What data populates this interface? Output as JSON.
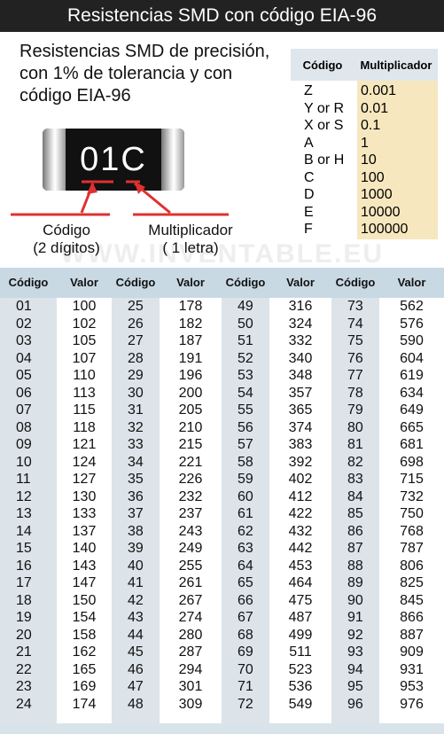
{
  "title": "Resistencias SMD con código EIA-96",
  "heading": [
    "Resistencias SMD de precisión,",
    "con 1% de tolerancia y con",
    "código EIA-96"
  ],
  "resistor": {
    "code": "01C"
  },
  "labels": {
    "codigo": "Código",
    "codigo_sub": "(2 dígitos)",
    "multiplicador": "Multiplicador",
    "multiplicador_sub": "( 1 letra)"
  },
  "watermark": "WWW.INVENTABLE.EU",
  "multiplier_table": {
    "headers": [
      "Código",
      "Multiplicador"
    ],
    "codes": [
      "Z",
      "Y or R",
      "X or S",
      "A",
      "B or H",
      "C",
      "D",
      "E",
      "F"
    ],
    "values": [
      "0.001",
      "0.01",
      "0.1",
      "1",
      "10",
      "100",
      "1000",
      "10000",
      "100000"
    ]
  },
  "value_table": {
    "headers": [
      "Código",
      "Valor",
      "Código",
      "Valor",
      "Código",
      "Valor",
      "Código",
      "Valor"
    ],
    "groups": [
      {
        "codes": [
          "01",
          "02",
          "03",
          "04",
          "05",
          "06",
          "07",
          "08",
          "09",
          "10",
          "11",
          "12",
          "13",
          "14",
          "15",
          "16",
          "17",
          "18",
          "19",
          "20",
          "21",
          "22",
          "23",
          "24"
        ],
        "values": [
          "100",
          "102",
          "105",
          "107",
          "110",
          "113",
          "115",
          "118",
          "121",
          "124",
          "127",
          "130",
          "133",
          "137",
          "140",
          "143",
          "147",
          "150",
          "154",
          "158",
          "162",
          "165",
          "169",
          "174"
        ]
      },
      {
        "codes": [
          "25",
          "26",
          "27",
          "28",
          "29",
          "30",
          "31",
          "32",
          "33",
          "34",
          "35",
          "36",
          "37",
          "38",
          "39",
          "40",
          "41",
          "42",
          "43",
          "44",
          "45",
          "46",
          "47",
          "48"
        ],
        "values": [
          "178",
          "182",
          "187",
          "191",
          "196",
          "200",
          "205",
          "210",
          "215",
          "221",
          "226",
          "232",
          "237",
          "243",
          "249",
          "255",
          "261",
          "267",
          "274",
          "280",
          "287",
          "294",
          "301",
          "309"
        ]
      },
      {
        "codes": [
          "49",
          "50",
          "51",
          "52",
          "53",
          "54",
          "55",
          "56",
          "57",
          "58",
          "59",
          "60",
          "61",
          "62",
          "63",
          "64",
          "65",
          "66",
          "67",
          "68",
          "69",
          "70",
          "71",
          "72"
        ],
        "values": [
          "316",
          "324",
          "332",
          "340",
          "348",
          "357",
          "365",
          "374",
          "383",
          "392",
          "402",
          "412",
          "422",
          "432",
          "442",
          "453",
          "464",
          "475",
          "487",
          "499",
          "511",
          "523",
          "536",
          "549"
        ]
      },
      {
        "codes": [
          "73",
          "74",
          "75",
          "76",
          "77",
          "78",
          "79",
          "80",
          "81",
          "82",
          "83",
          "84",
          "85",
          "86",
          "87",
          "88",
          "89",
          "90",
          "91",
          "92",
          "93",
          "94",
          "95",
          "96"
        ],
        "values": [
          "562",
          "576",
          "590",
          "604",
          "619",
          "634",
          "649",
          "665",
          "681",
          "698",
          "715",
          "732",
          "750",
          "768",
          "787",
          "806",
          "825",
          "845",
          "866",
          "887",
          "909",
          "931",
          "953",
          "976"
        ]
      }
    ]
  },
  "colors": {
    "title_bg": "#222222",
    "mult_value_bg": "#f7e7be",
    "table_bg": "#d9e3ea",
    "callout": "#e03030"
  }
}
